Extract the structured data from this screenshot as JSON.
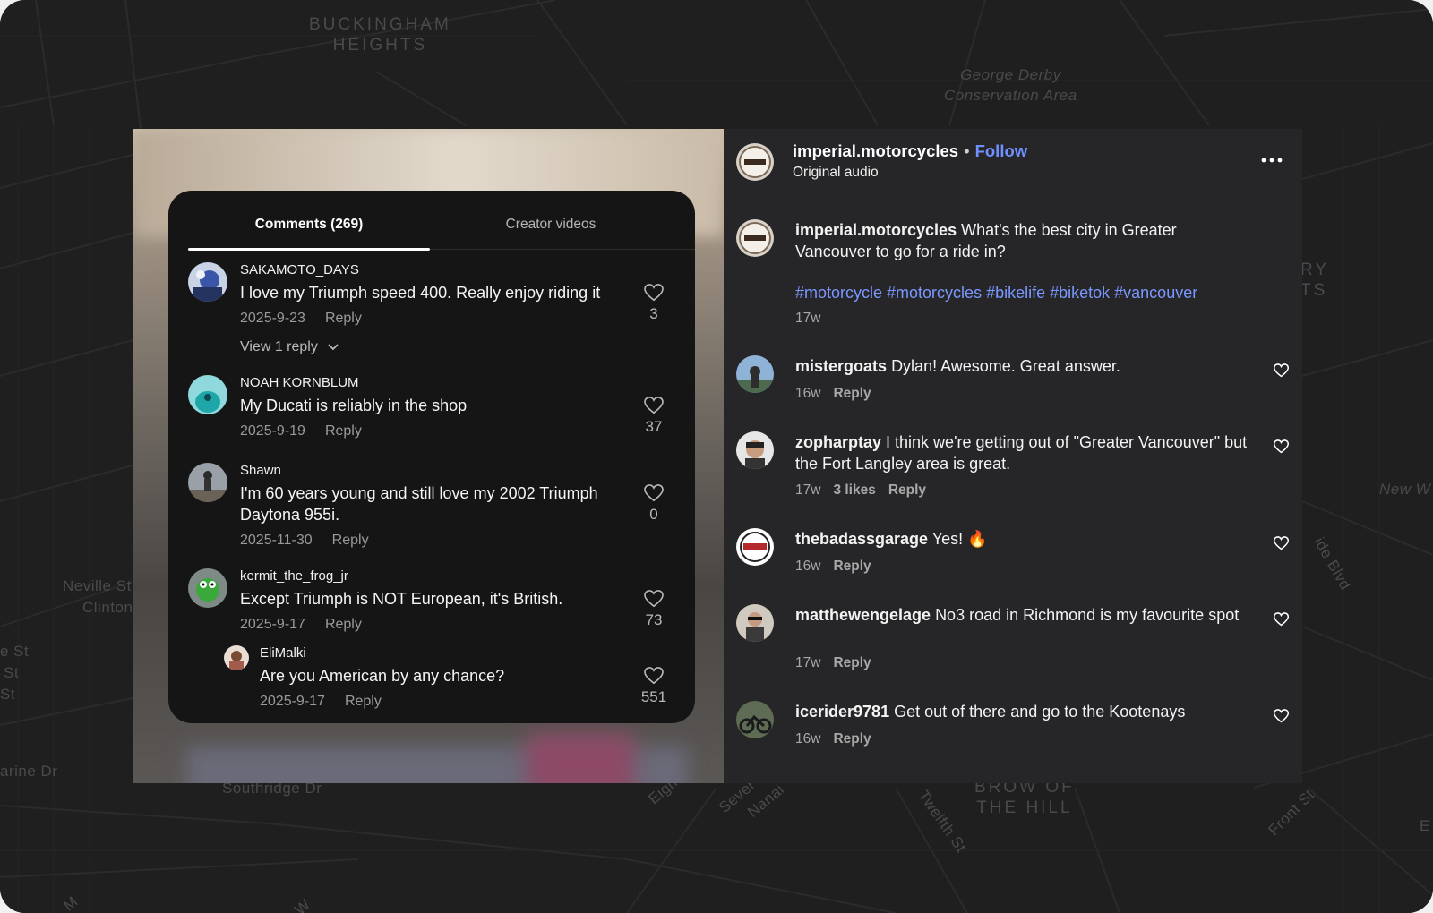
{
  "map": {
    "labels": {
      "buckingham": "BUCKINGHAM\nHEIGHTS",
      "george_derby": "George Derby\nConservation Area",
      "neville": "Neville St",
      "clinton": "Clinton",
      "e_st": "e St",
      "st1": "St",
      "st2": "St",
      "marine": "arine Dr",
      "southridge": "Southridge Dr",
      "eight": "Eight",
      "sever": "Sever",
      "nana": "Nanai",
      "brow": "BROW OF\nTHE HILL",
      "twelfth": "Twelfth St",
      "front": "Front St",
      "ry": "RY\nTS",
      "new_w": "New W",
      "ide_blvd": "ide Blvd",
      "e_right": "E",
      "m_left": "M",
      "w_left": "W"
    }
  },
  "comments_panel": {
    "tabs": [
      {
        "label": "Comments (269)",
        "active": true
      },
      {
        "label": "Creator videos",
        "active": false
      }
    ],
    "comments": [
      {
        "name": "SAKAMOTO_DAYS",
        "text": "I love my Triumph speed 400. Really enjoy riding it",
        "date": "2025-9-23",
        "reply": "Reply",
        "likes": "3",
        "view_replies": "View 1 reply"
      },
      {
        "name": "NOAH KORNBLUM",
        "text": "My Ducati is reliably in the shop",
        "date": "2025-9-19",
        "reply": "Reply",
        "likes": "37"
      },
      {
        "name": "Shawn",
        "text": "I'm 60 years young and still love my 2002 Triumph Daytona 955i.",
        "date": "2025-11-30",
        "reply": "Reply",
        "likes": "0"
      },
      {
        "name": "kermit_the_frog_jr",
        "text": "Except Triumph is NOT European, it's British.",
        "date": "2025-9-17",
        "reply": "Reply",
        "likes": "73"
      },
      {
        "name": "EliMalki",
        "text": "Are you American by any chance?",
        "date": "2025-9-17",
        "reply": "Reply",
        "likes": "551"
      }
    ]
  },
  "instagram_panel": {
    "header": {
      "username": "imperial.motorcycles",
      "separator": "•",
      "follow": "Follow",
      "subtitle": "Original audio",
      "more_icon": "more-horizontal-icon"
    },
    "caption": {
      "username": "imperial.motorcycles",
      "text": "What's the best city in Greater Vancouver to go for a ride in?",
      "hashtags": "#motorcycle #motorcycles #bikelife #biketok #vancouver",
      "age": "17w"
    },
    "comments": [
      {
        "username": "mistergoats",
        "text": "Dylan! Awesome. Great answer.",
        "age": "16w",
        "likes": "",
        "reply": "Reply"
      },
      {
        "username": "zopharptay",
        "text": "I think we're getting out of \"Greater Vancouver\" but the Fort Langley area is great.",
        "age": "17w",
        "likes": "3 likes",
        "reply": "Reply"
      },
      {
        "username": "thebadassgarage",
        "text": "Yes! 🔥",
        "age": "16w",
        "likes": "",
        "reply": "Reply"
      },
      {
        "username": "matthewengelage",
        "text": "No3 road in Richmond is my favourite spot",
        "age": "17w",
        "likes": "",
        "reply": "Reply"
      },
      {
        "username": "icerider9781",
        "text": "Get out of there and go to the Kootenays",
        "age": "16w",
        "likes": "",
        "reply": "Reply"
      }
    ]
  },
  "colors": {
    "accent_blue": "#7090ff",
    "hashtag_blue": "#7a98ff",
    "panel_bg": "#262629",
    "card_bg": "#151515"
  }
}
